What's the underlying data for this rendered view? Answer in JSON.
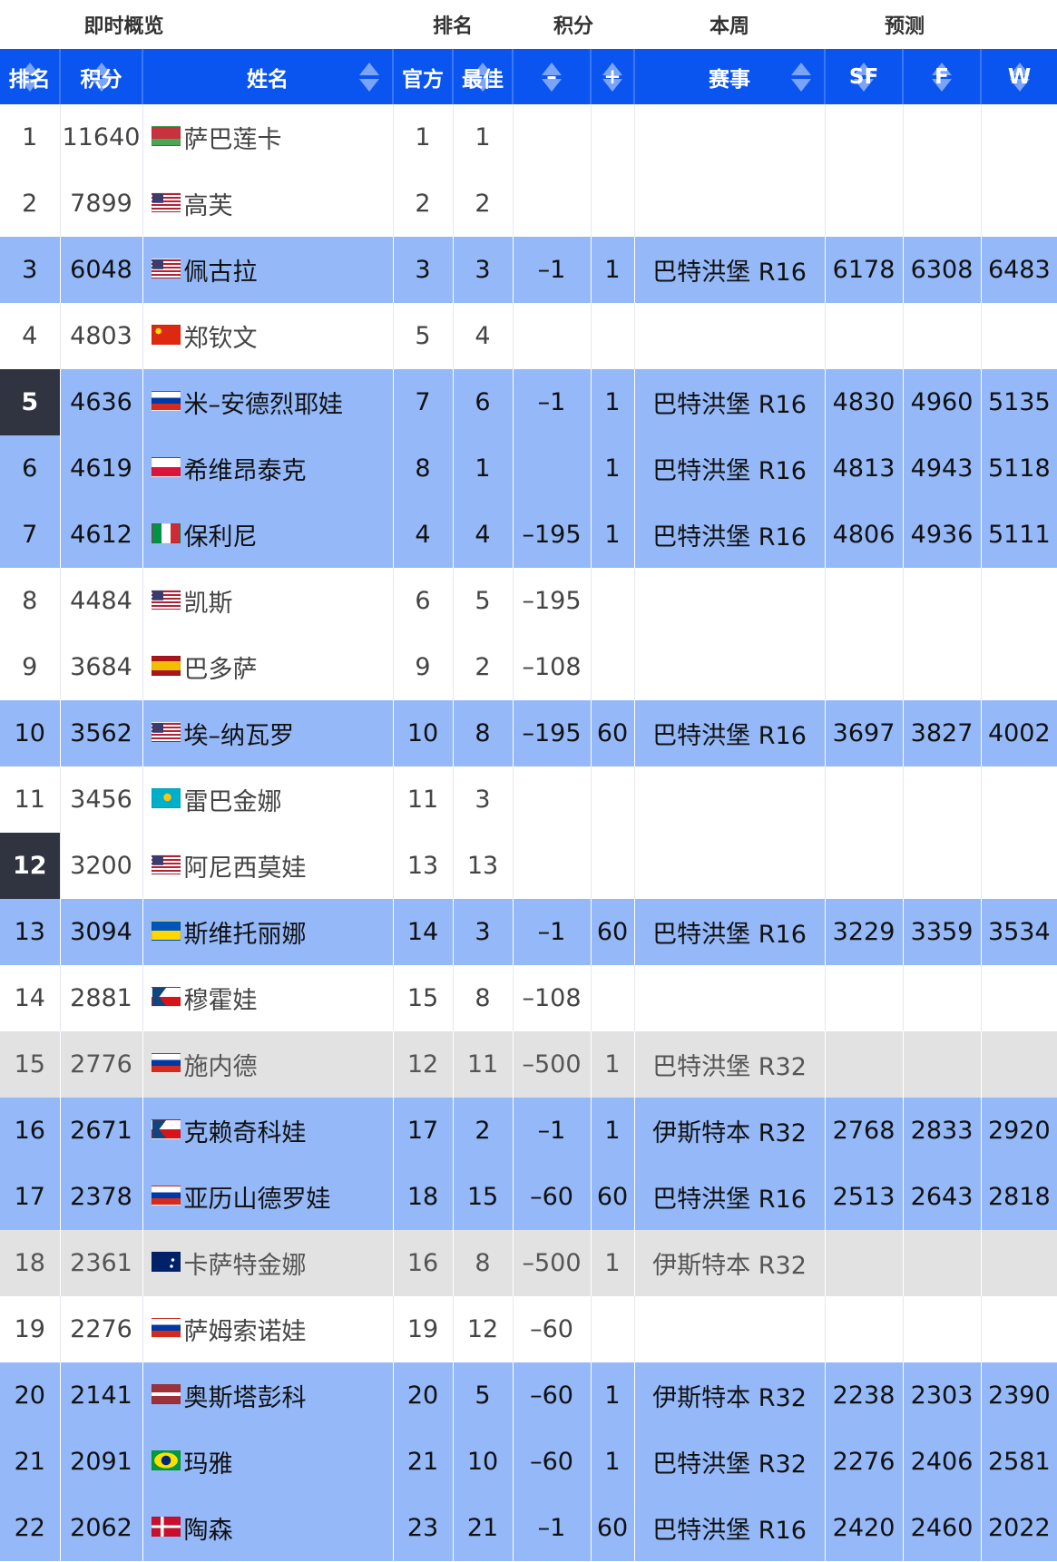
{
  "header_groups": {
    "overview": "即时概览",
    "ranking": "排名",
    "points": "积分",
    "this_week": "本周",
    "forecast": "预测"
  },
  "columns": {
    "rank": "排名",
    "points": "积分",
    "name": "姓名",
    "official": "官方",
    "best": "最佳",
    "minus": "–",
    "plus": "+",
    "event": "赛事",
    "sf": "SF",
    "f": "F",
    "w": "W"
  },
  "rows": [
    {
      "rank": "1",
      "points": "11640",
      "flag": "belarus",
      "name": "萨巴莲卡",
      "official": "1",
      "best": "1",
      "minus": "",
      "plus": "",
      "event": "",
      "sf": "",
      "f": "",
      "w": "",
      "style": "plain",
      "rank_highlight": false
    },
    {
      "rank": "2",
      "points": "7899",
      "flag": "usa",
      "name": "高芙",
      "official": "2",
      "best": "2",
      "minus": "",
      "plus": "",
      "event": "",
      "sf": "",
      "f": "",
      "w": "",
      "style": "plain",
      "rank_highlight": false
    },
    {
      "rank": "3",
      "points": "6048",
      "flag": "usa",
      "name": "佩古拉",
      "official": "3",
      "best": "3",
      "minus": "–1",
      "plus": "1",
      "event": "巴特洪堡 R16",
      "sf": "6178",
      "f": "6308",
      "w": "6483",
      "style": "blue",
      "rank_highlight": false
    },
    {
      "rank": "4",
      "points": "4803",
      "flag": "china",
      "name": "郑钦文",
      "official": "5",
      "best": "4",
      "minus": "",
      "plus": "",
      "event": "",
      "sf": "",
      "f": "",
      "w": "",
      "style": "plain",
      "rank_highlight": false
    },
    {
      "rank": "5",
      "points": "4636",
      "flag": "russia",
      "name": "米–安德烈耶娃",
      "official": "7",
      "best": "6",
      "minus": "–1",
      "plus": "1",
      "event": "巴特洪堡 R16",
      "sf": "4830",
      "f": "4960",
      "w": "5135",
      "style": "blue",
      "rank_highlight": true
    },
    {
      "rank": "6",
      "points": "4619",
      "flag": "poland",
      "name": "希维昂泰克",
      "official": "8",
      "best": "1",
      "minus": "",
      "plus": "1",
      "event": "巴特洪堡 R16",
      "sf": "4813",
      "f": "4943",
      "w": "5118",
      "style": "blue",
      "rank_highlight": false
    },
    {
      "rank": "7",
      "points": "4612",
      "flag": "italy",
      "name": "保利尼",
      "official": "4",
      "best": "4",
      "minus": "–195",
      "plus": "1",
      "event": "巴特洪堡 R16",
      "sf": "4806",
      "f": "4936",
      "w": "5111",
      "style": "blue",
      "rank_highlight": false
    },
    {
      "rank": "8",
      "points": "4484",
      "flag": "usa",
      "name": "凯斯",
      "official": "6",
      "best": "5",
      "minus": "–195",
      "plus": "",
      "event": "",
      "sf": "",
      "f": "",
      "w": "",
      "style": "plain",
      "rank_highlight": false
    },
    {
      "rank": "9",
      "points": "3684",
      "flag": "spain",
      "name": "巴多萨",
      "official": "9",
      "best": "2",
      "minus": "–108",
      "plus": "",
      "event": "",
      "sf": "",
      "f": "",
      "w": "",
      "style": "plain",
      "rank_highlight": false
    },
    {
      "rank": "10",
      "points": "3562",
      "flag": "usa",
      "name": "埃–纳瓦罗",
      "official": "10",
      "best": "8",
      "minus": "–195",
      "plus": "60",
      "event": "巴特洪堡 R16",
      "sf": "3697",
      "f": "3827",
      "w": "4002",
      "style": "blue",
      "rank_highlight": false
    },
    {
      "rank": "11",
      "points": "3456",
      "flag": "kazakhstan",
      "name": "雷巴金娜",
      "official": "11",
      "best": "3",
      "minus": "",
      "plus": "",
      "event": "",
      "sf": "",
      "f": "",
      "w": "",
      "style": "plain",
      "rank_highlight": false
    },
    {
      "rank": "12",
      "points": "3200",
      "flag": "usa",
      "name": "阿尼西莫娃",
      "official": "13",
      "best": "13",
      "minus": "",
      "plus": "",
      "event": "",
      "sf": "",
      "f": "",
      "w": "",
      "style": "plain",
      "rank_highlight": true
    },
    {
      "rank": "13",
      "points": "3094",
      "flag": "ukraine",
      "name": "斯维托丽娜",
      "official": "14",
      "best": "3",
      "minus": "–1",
      "plus": "60",
      "event": "巴特洪堡 R16",
      "sf": "3229",
      "f": "3359",
      "w": "3534",
      "style": "blue",
      "rank_highlight": false
    },
    {
      "rank": "14",
      "points": "2881",
      "flag": "czech",
      "name": "穆霍娃",
      "official": "15",
      "best": "8",
      "minus": "–108",
      "plus": "",
      "event": "",
      "sf": "",
      "f": "",
      "w": "",
      "style": "plain",
      "rank_highlight": false
    },
    {
      "rank": "15",
      "points": "2776",
      "flag": "russia",
      "name": "施内德",
      "official": "12",
      "best": "11",
      "minus": "–500",
      "plus": "1",
      "event": "巴特洪堡 R32",
      "sf": "",
      "f": "",
      "w": "",
      "style": "gray",
      "rank_highlight": false
    },
    {
      "rank": "16",
      "points": "2671",
      "flag": "czech",
      "name": "克赖奇科娃",
      "official": "17",
      "best": "2",
      "minus": "–1",
      "plus": "1",
      "event": "伊斯特本 R32",
      "sf": "2768",
      "f": "2833",
      "w": "2920",
      "style": "blue",
      "rank_highlight": false
    },
    {
      "rank": "17",
      "points": "2378",
      "flag": "russia",
      "name": "亚历山德罗娃",
      "official": "18",
      "best": "15",
      "minus": "–60",
      "plus": "60",
      "event": "巴特洪堡 R16",
      "sf": "2513",
      "f": "2643",
      "w": "2818",
      "style": "blue",
      "rank_highlight": false
    },
    {
      "rank": "18",
      "points": "2361",
      "flag": "australia",
      "name": "卡萨特金娜",
      "official": "16",
      "best": "8",
      "minus": "–500",
      "plus": "1",
      "event": "伊斯特本 R32",
      "sf": "",
      "f": "",
      "w": "",
      "style": "gray",
      "rank_highlight": false
    },
    {
      "rank": "19",
      "points": "2276",
      "flag": "russia",
      "name": "萨姆索诺娃",
      "official": "19",
      "best": "12",
      "minus": "–60",
      "plus": "",
      "event": "",
      "sf": "",
      "f": "",
      "w": "",
      "style": "plain",
      "rank_highlight": false
    },
    {
      "rank": "20",
      "points": "2141",
      "flag": "latvia",
      "name": "奥斯塔彭科",
      "official": "20",
      "best": "5",
      "minus": "–60",
      "plus": "1",
      "event": "伊斯特本 R32",
      "sf": "2238",
      "f": "2303",
      "w": "2390",
      "style": "blue",
      "rank_highlight": false
    },
    {
      "rank": "21",
      "points": "2091",
      "flag": "brazil",
      "name": "玛雅",
      "official": "21",
      "best": "10",
      "minus": "–60",
      "plus": "1",
      "event": "巴特洪堡 R32",
      "sf": "2276",
      "f": "2406",
      "w": "2581",
      "style": "blue",
      "rank_highlight": false
    },
    {
      "rank": "22",
      "points": "2062",
      "flag": "denmark",
      "name": "陶森",
      "official": "23",
      "best": "21",
      "minus": "–1",
      "plus": "60",
      "event": "巴特洪堡 R16",
      "sf": "2420",
      "f": "2460",
      "w": "2022",
      "style": "blue",
      "rank_highlight": false
    }
  ]
}
